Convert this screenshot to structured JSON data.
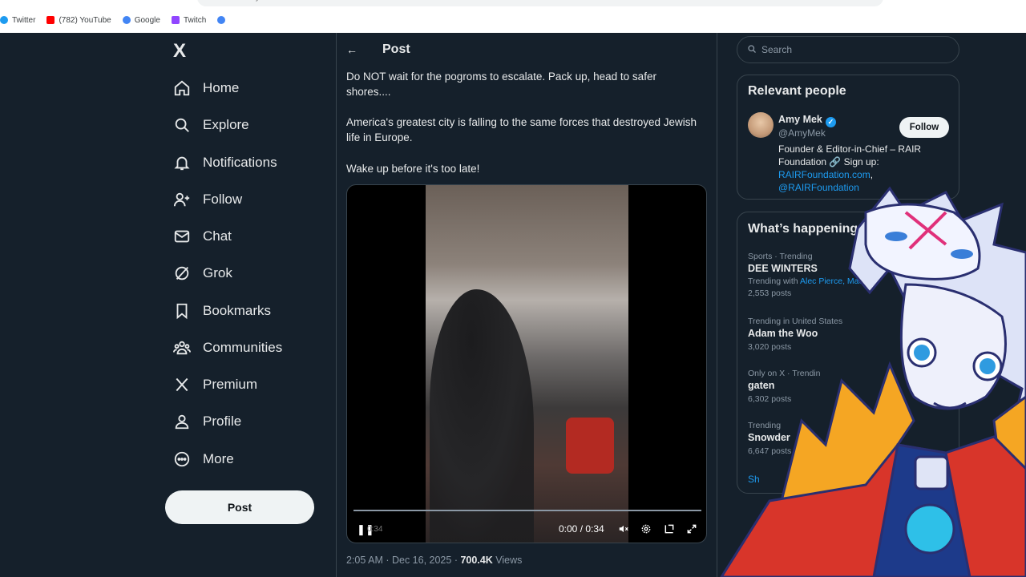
{
  "browser": {
    "url": "x.com/AmyMek/status/2000624576457645956",
    "bookmarks": [
      {
        "label": "Twitter",
        "color": "#1d9bf0"
      },
      {
        "label": "(782) YouTube",
        "color": "#ff0000"
      },
      {
        "label": "Google",
        "color": "#4285f4"
      },
      {
        "label": "Twitch",
        "color": "#9146ff"
      },
      {
        "label": "",
        "color": "#4285f4"
      }
    ]
  },
  "nav": {
    "logo": "X",
    "items": [
      {
        "label": "Home",
        "icon": "home-icon"
      },
      {
        "label": "Explore",
        "icon": "search-icon"
      },
      {
        "label": "Notifications",
        "icon": "bell-icon"
      },
      {
        "label": "Follow",
        "icon": "person-add-icon"
      },
      {
        "label": "Chat",
        "icon": "mail-icon"
      },
      {
        "label": "Grok",
        "icon": "grok-icon"
      },
      {
        "label": "Bookmarks",
        "icon": "bookmark-icon"
      },
      {
        "label": "Communities",
        "icon": "people-icon"
      },
      {
        "label": "Premium",
        "icon": "x-icon"
      },
      {
        "label": "Profile",
        "icon": "person-icon"
      },
      {
        "label": "More",
        "icon": "more-icon"
      }
    ],
    "post_button": "Post"
  },
  "header": {
    "title": "Post"
  },
  "tweet": {
    "paragraphs": [
      "Do NOT wait for the pogroms to escalate. Pack up, head to safer shores....",
      "America's greatest city is falling to the same forces that destroyed Jewish life in Europe.",
      "Wake up before it's too late!"
    ],
    "video": {
      "time": "0:00 / 0:34",
      "remaining": "0:34",
      "progress_fraction": 0.0
    },
    "meta": {
      "time": "2:05 AM · Dec 16, 2025",
      "separator": "·",
      "views_count": "700.4K",
      "views_label": "Views"
    }
  },
  "sidebar": {
    "search_placeholder": "Search",
    "relevant_people": {
      "title": "Relevant people",
      "name": "Amy Mek",
      "handle": "@AmyMek",
      "follow": "Follow",
      "bio_text": "Founder & Editor-in-Chief – RAIR Foundation 🔗 Sign up:",
      "bio_link1": "RAIRFoundation.com",
      "bio_comma": ",",
      "bio_link2": "@RAIRFoundation"
    },
    "whats_happening": {
      "title": "What’s happening",
      "trends": [
        {
          "meta": "Sports · Trending",
          "name": "DEE WINTERS",
          "extra_prefix": "Trending with ",
          "extra_link": "Alec Pierce, Mac",
          "posts": "2,553 posts"
        },
        {
          "meta": "Trending in United States",
          "name": "Adam the Woo",
          "extra_prefix": "",
          "extra_link": "",
          "posts": "3,020 posts"
        },
        {
          "meta": "Only on X · Trendin",
          "name": "gaten",
          "extra_prefix": "",
          "extra_link": "",
          "posts": "6,302 posts"
        },
        {
          "meta": "Trending",
          "name": "Snowder",
          "extra_prefix": "",
          "extra_link": "",
          "posts": "6,647 posts"
        }
      ],
      "show_more": "Sh"
    }
  },
  "colors": {
    "background": "#15202b",
    "accent": "#1d9bf0",
    "border": "#38444d",
    "muted_text": "#8b98a5"
  }
}
